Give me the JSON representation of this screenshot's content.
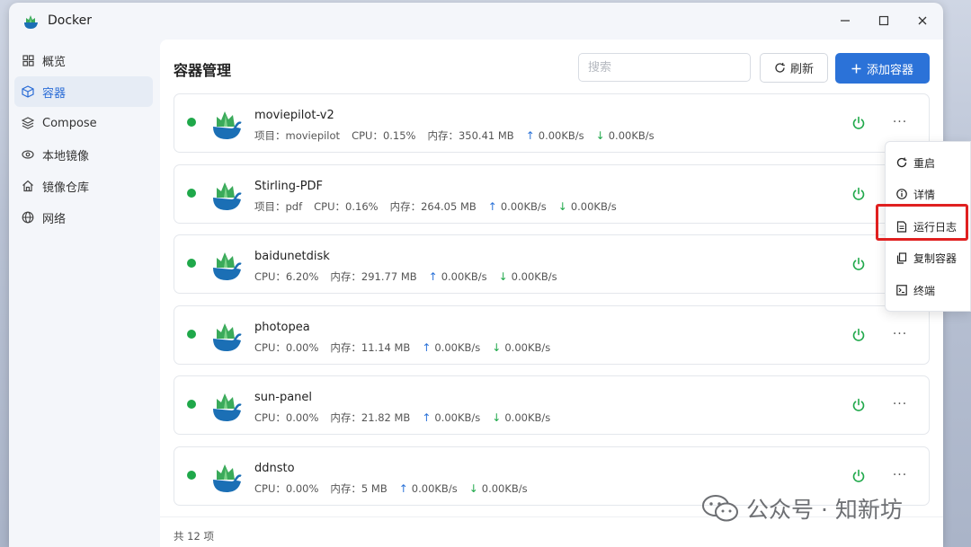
{
  "window": {
    "title": "Docker"
  },
  "sidebar": {
    "items": [
      {
        "label": "概览",
        "icon": "grid-icon"
      },
      {
        "label": "容器",
        "icon": "cube-icon",
        "active": true
      },
      {
        "label": "Compose",
        "icon": "layers-icon"
      },
      {
        "label": "本地镜像",
        "icon": "eye-icon"
      },
      {
        "label": "镜像仓库",
        "icon": "home-icon"
      },
      {
        "label": "网络",
        "icon": "globe-icon"
      }
    ]
  },
  "main": {
    "title": "容器管理",
    "search_placeholder": "搜索",
    "refresh_label": "刷新",
    "add_label": "添加容器",
    "total": "共 12 项"
  },
  "containers": [
    {
      "name": "moviepilot-v2",
      "project": "项目：moviepilot",
      "cpu": "CPU：0.15%",
      "mem": "内存：350.41 MB",
      "up": "0.00KB/s",
      "down": "0.00KB/s",
      "status": "running"
    },
    {
      "name": "Stirling-PDF",
      "project": "项目：pdf",
      "cpu": "CPU：0.16%",
      "mem": "内存：264.05 MB",
      "up": "0.00KB/s",
      "down": "0.00KB/s",
      "status": "running"
    },
    {
      "name": "baidunetdisk",
      "cpu": "CPU：6.20%",
      "mem": "内存：291.77 MB",
      "up": "0.00KB/s",
      "down": "0.00KB/s",
      "status": "running"
    },
    {
      "name": "photopea",
      "cpu": "CPU：0.00%",
      "mem": "内存：11.14 MB",
      "up": "0.00KB/s",
      "down": "0.00KB/s",
      "status": "running"
    },
    {
      "name": "sun-panel",
      "cpu": "CPU：0.00%",
      "mem": "内存：21.82 MB",
      "up": "0.00KB/s",
      "down": "0.00KB/s",
      "status": "running"
    },
    {
      "name": "ddnsto",
      "cpu": "CPU：0.00%",
      "mem": "内存：5 MB",
      "up": "0.00KB/s",
      "down": "0.00KB/s",
      "status": "running"
    }
  ],
  "context_menu": {
    "items": [
      {
        "label": "重启",
        "icon": "restart-icon"
      },
      {
        "label": "详情",
        "icon": "info-icon"
      },
      {
        "label": "运行日志",
        "icon": "document-icon",
        "highlighted": true
      },
      {
        "label": "复制容器",
        "icon": "copy-icon"
      },
      {
        "label": "终端",
        "icon": "terminal-icon"
      }
    ]
  },
  "watermark": {
    "text": "公众号 · 知新坊"
  },
  "colors": {
    "accent": "#2b72d8",
    "running": "#1fa84a",
    "highlight": "#e02020"
  }
}
